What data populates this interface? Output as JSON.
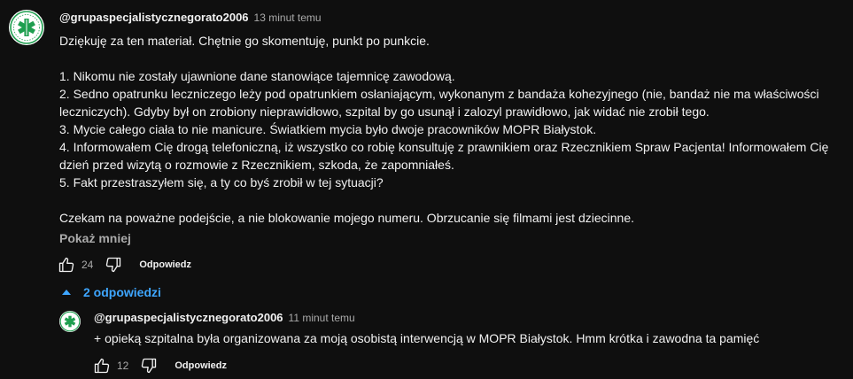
{
  "comment": {
    "author": "@grupaspecjalistycznegorato2006",
    "time": "13 minut temu",
    "paragraphs": [
      "Dziękuję za ten materiał. Chętnie go skomentuję, punkt po punkcie.",
      "",
      "1. Nikomu nie zostały ujawnione dane stanowiące tajemnicę zawodową.",
      "2. Sedno opatrunku leczniczego leży pod opatrunkiem osłaniającym, wykonanym z bandaża kohezyjnego (nie, bandaż nie ma właściwości leczniczych). Gdyby był on zrobiony nieprawidłowo, szpital by go usunął i zalozyl prawidłowo, jak widać nie zrobił tego.",
      "3. Mycie całego ciała to nie manicure. Światkiem mycia było dwoje pracowników MOPR Białystok.",
      "4. Informowałem Cię drogą telefoniczną, iż wszystko co robię konsultuję z prawnikiem oraz Rzecznikiem Spraw Pacjenta! Informowałem Cię dzień przed wizytą o rozmowie z Rzecznikiem, szkoda, że zapomniałeś.",
      "5. Fakt przestraszyłem się, a ty co byś zrobił w tej sytuacji?",
      "",
      "Czekam na poważne podejście, a nie blokowanie mojego numeru. Obrzucanie się filmami jest dziecinne."
    ],
    "show_less": "Pokaż mniej",
    "likes": "24",
    "reply_label": "Odpowiedz"
  },
  "replies_toggle": {
    "label": "2 odpowiedzi",
    "icon": "chevron-up-icon",
    "color": "#3ea6ff"
  },
  "reply": {
    "author": "@grupaspecjalistycznegorato2006",
    "time": "11 minut temu",
    "text": "+ opieką szpitalna była organizowana za moją osobistą interwencją w MOPR Białystok. Hmm krótka i zawodna ta pamięć",
    "likes": "12",
    "reply_label": "Odpowiedz"
  },
  "colors": {
    "background": "#0f0f0f",
    "text": "#f1f1f1",
    "secondary": "#aaaaaa",
    "link": "#3ea6ff",
    "avatar_logo": "#1e9e4f"
  }
}
